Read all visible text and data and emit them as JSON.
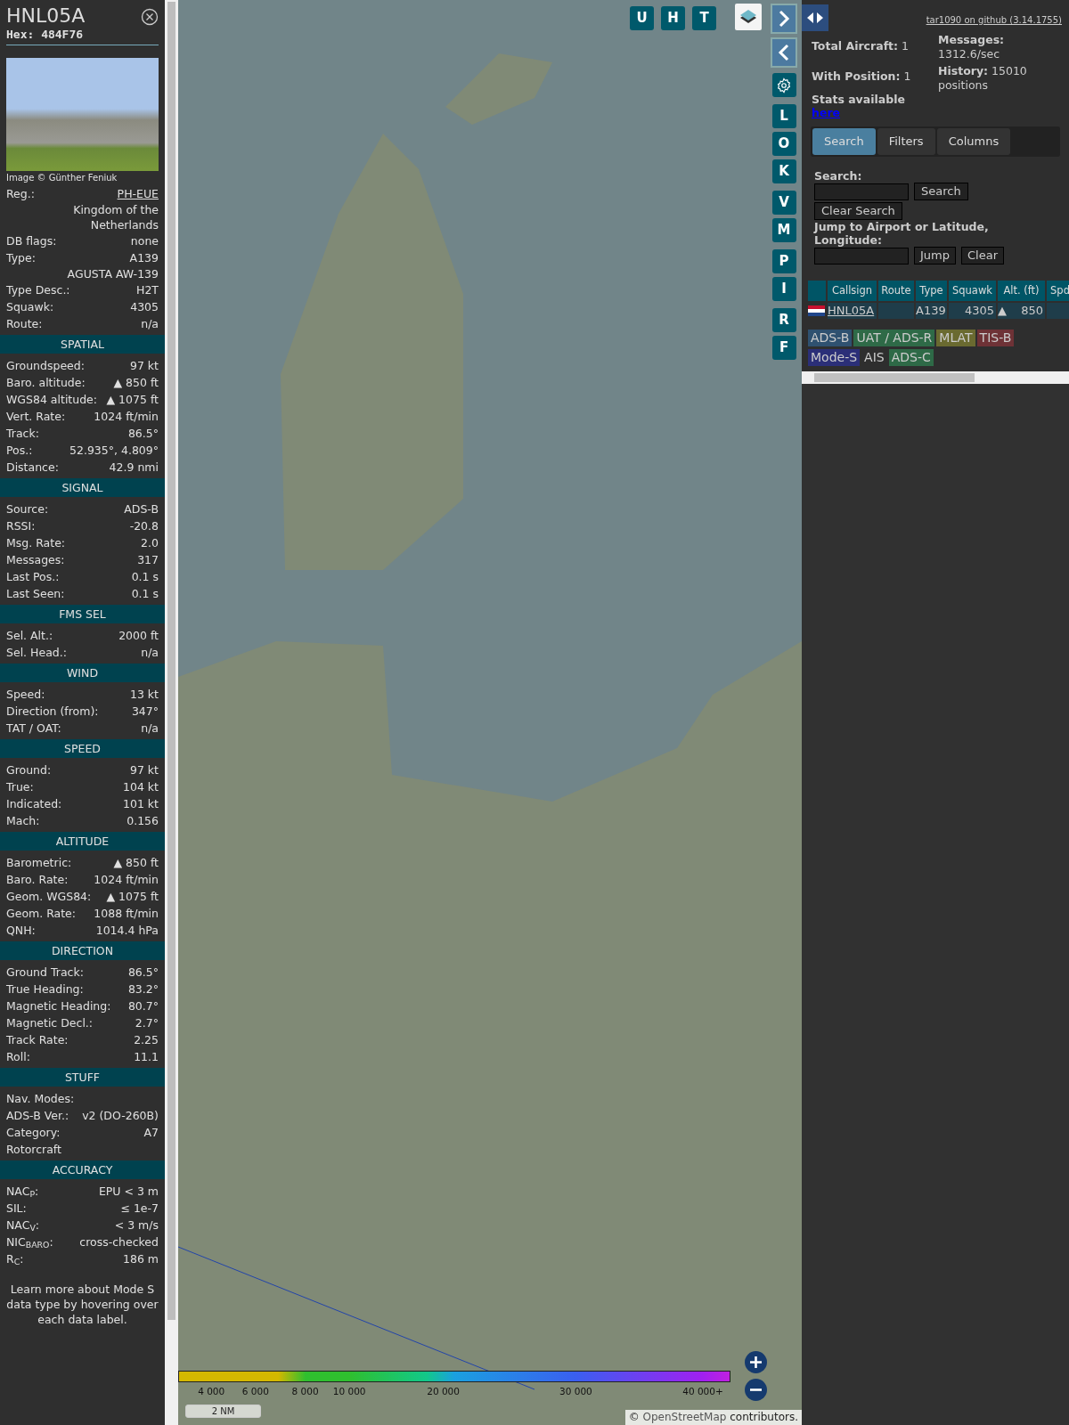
{
  "info_panel": {
    "callsign": "HNL05A",
    "hex": "Hex: 484F76",
    "photo_credit": "Image © Günther Feniuk",
    "details": [
      {
        "kind": "link",
        "label": "Reg.:",
        "value": "PH-EUE"
      },
      {
        "kind": "value",
        "value": "Kingdom of the Netherlands"
      },
      {
        "kind": "pair",
        "label": "DB flags:",
        "value": "none"
      },
      {
        "kind": "pair",
        "label": "Type:",
        "value": "A139"
      },
      {
        "kind": "value",
        "value": "AGUSTA AW-139"
      },
      {
        "kind": "pair",
        "label": "Type Desc.:",
        "value": "H2T"
      },
      {
        "kind": "pair",
        "label": "Squawk:",
        "value": "4305"
      },
      {
        "kind": "pair",
        "label": "Route:",
        "value": "n/a"
      }
    ],
    "sections": [
      {
        "title": "SPATIAL",
        "rows": [
          {
            "kind": "pair",
            "label": "Groundspeed:",
            "value": "97 kt"
          },
          {
            "kind": "pair",
            "label": "Baro. altitude:",
            "value": "▲ 850 ft"
          },
          {
            "kind": "pair",
            "label": "WGS84 altitude:",
            "value": "▲ 1075 ft"
          },
          {
            "kind": "pair",
            "label": "Vert. Rate:",
            "value": "1024 ft/min"
          },
          {
            "kind": "pair",
            "label": "Track:",
            "value": "86.5°"
          },
          {
            "kind": "pair",
            "label": "Pos.:",
            "value": "52.935°, 4.809°"
          },
          {
            "kind": "pair",
            "label": "Distance:",
            "value": "42.9 nmi"
          }
        ]
      },
      {
        "title": "SIGNAL",
        "rows": [
          {
            "kind": "pair",
            "label": "Source:",
            "value": "ADS-B"
          },
          {
            "kind": "pair",
            "label": "RSSI:",
            "value": "-20.8"
          },
          {
            "kind": "pair",
            "label": "Msg. Rate:",
            "value": "2.0"
          },
          {
            "kind": "pair",
            "label": "Messages:",
            "value": "317"
          },
          {
            "kind": "pair",
            "label": "Last Pos.:",
            "value": "0.1 s"
          },
          {
            "kind": "pair",
            "label": "Last Seen:",
            "value": "0.1 s"
          }
        ]
      },
      {
        "title": "FMS SEL",
        "rows": [
          {
            "kind": "pair",
            "label": "Sel. Alt.:",
            "value": "2000 ft"
          },
          {
            "kind": "pair",
            "label": "Sel. Head.:",
            "value": "n/a"
          }
        ]
      },
      {
        "title": "WIND",
        "rows": [
          {
            "kind": "pair",
            "label": "Speed:",
            "value": "13 kt"
          },
          {
            "kind": "pair",
            "label": "Direction (from):",
            "value": "347°"
          },
          {
            "kind": "pair",
            "label": "TAT / OAT:",
            "value": "n/a"
          }
        ]
      },
      {
        "title": "SPEED",
        "rows": [
          {
            "kind": "pair",
            "label": "Ground:",
            "value": "97 kt"
          },
          {
            "kind": "pair",
            "label": "True:",
            "value": "104 kt"
          },
          {
            "kind": "pair",
            "label": "Indicated:",
            "value": "101 kt"
          },
          {
            "kind": "pair",
            "label": "Mach:",
            "value": "0.156"
          }
        ]
      },
      {
        "title": "ALTITUDE",
        "rows": [
          {
            "kind": "pair",
            "label": "Barometric:",
            "value": "▲ 850 ft"
          },
          {
            "kind": "pair",
            "label": "Baro. Rate:",
            "value": "1024 ft/min"
          },
          {
            "kind": "pair",
            "label": "Geom. WGS84:",
            "value": "▲ 1075 ft"
          },
          {
            "kind": "pair",
            "label": "Geom. Rate:",
            "value": "1088 ft/min"
          },
          {
            "kind": "pair",
            "label": "QNH:",
            "value": "1014.4 hPa"
          }
        ]
      },
      {
        "title": "DIRECTION",
        "rows": [
          {
            "kind": "pair",
            "label": "Ground Track:",
            "value": "86.5°"
          },
          {
            "kind": "pair",
            "label": "True Heading:",
            "value": "83.2°"
          },
          {
            "kind": "pair",
            "label": "Magnetic Heading:",
            "value": "80.7°"
          },
          {
            "kind": "pair",
            "label": "Magnetic Decl.:",
            "value": "2.7°"
          },
          {
            "kind": "pair",
            "label": "Track Rate:",
            "value": "2.25"
          },
          {
            "kind": "pair",
            "label": "Roll:",
            "value": "11.1"
          }
        ]
      },
      {
        "title": "STUFF",
        "rows": [
          {
            "kind": "label",
            "label": "Nav. Modes:"
          },
          {
            "kind": "pair",
            "label": "ADS-B Ver.:",
            "value": "v2 (DO-260B)"
          },
          {
            "kind": "pair",
            "label": "Category:",
            "value": "A7"
          },
          {
            "kind": "label",
            "label": "Rotorcraft"
          }
        ]
      },
      {
        "title": "ACCURACY",
        "rows": [
          {
            "kind": "pair",
            "label": "NAC$_{P}$:",
            "value": "EPU < 3 m"
          },
          {
            "kind": "pair",
            "label": "SIL:",
            "value": "≤ 1e-7"
          },
          {
            "kind": "pair",
            "label": "NAC$_{V}$:",
            "value": "< 3 m/s"
          },
          {
            "kind": "pair",
            "label": "NIC$_{BARO}$:",
            "value": "cross-checked"
          },
          {
            "kind": "pair",
            "label": "R$_{C}$:",
            "value": "186 m"
          }
        ]
      }
    ],
    "footer": "Learn more about Mode S data type by hovering over each data label."
  },
  "map": {
    "top_buttons": [
      "U",
      "H",
      "T"
    ],
    "side_button_groups": [
      [
        "L",
        "O",
        "K"
      ],
      [
        "V",
        "M"
      ],
      [
        "P",
        "I"
      ],
      [
        "R",
        "F"
      ]
    ],
    "legend_ticks": [
      "4 000",
      "6 000",
      "8 000",
      "10 000",
      "20 000",
      "30 000",
      "40 000+"
    ],
    "scale": "2 NM",
    "attribution": {
      "prefix": "©",
      "link": "OpenStreetMap",
      "suffix": "contributors."
    }
  },
  "sidebar": {
    "github_link": "tar1090 on github (3.14.1755)",
    "stats_left": [
      "**Total Aircraft:** 1",
      "**With Position:** 1"
    ],
    "stats_available": "Stats available",
    "stats_link": "here",
    "stats_right": [
      "**Messages:** 1312.6/sec",
      "**History:** 15010 positions"
    ],
    "tabs": [
      {
        "label": "Search",
        "selected": true
      },
      {
        "label": "Filters",
        "selected": false
      },
      {
        "label": "Columns",
        "selected": false
      }
    ],
    "search": {
      "label": "Search:",
      "button": "Search",
      "clear_button": "Clear Search",
      "jump_label": "Jump to Airport or Latitude, Longitude:",
      "jump_button": "Jump",
      "clear_jump_button": "Clear"
    },
    "table": {
      "columns": [
        "Callsign",
        "Route",
        "Type",
        "Squawk",
        "Alt. (ft)",
        "Spd"
      ],
      "rows": [
        {
          "callsign": "HNL05A",
          "type": "A139",
          "squawk": "4305",
          "alt_trend": "▲",
          "altitude": "850"
        }
      ]
    },
    "source_tags": [
      {
        "label": "ADS-B",
        "color": "#2f5170"
      },
      {
        "label": "UAT / ADS-R",
        "color": "#2e6a47"
      },
      {
        "label": "MLAT",
        "color": "#6a6a30"
      },
      {
        "label": "TIS-B",
        "color": "#6e3236"
      },
      {
        "label": "Mode-S",
        "color": "#2b2f78"
      },
      {
        "label": "AIS"
      },
      {
        "label": "ADS-C",
        "color": "#2e6a47"
      }
    ]
  }
}
